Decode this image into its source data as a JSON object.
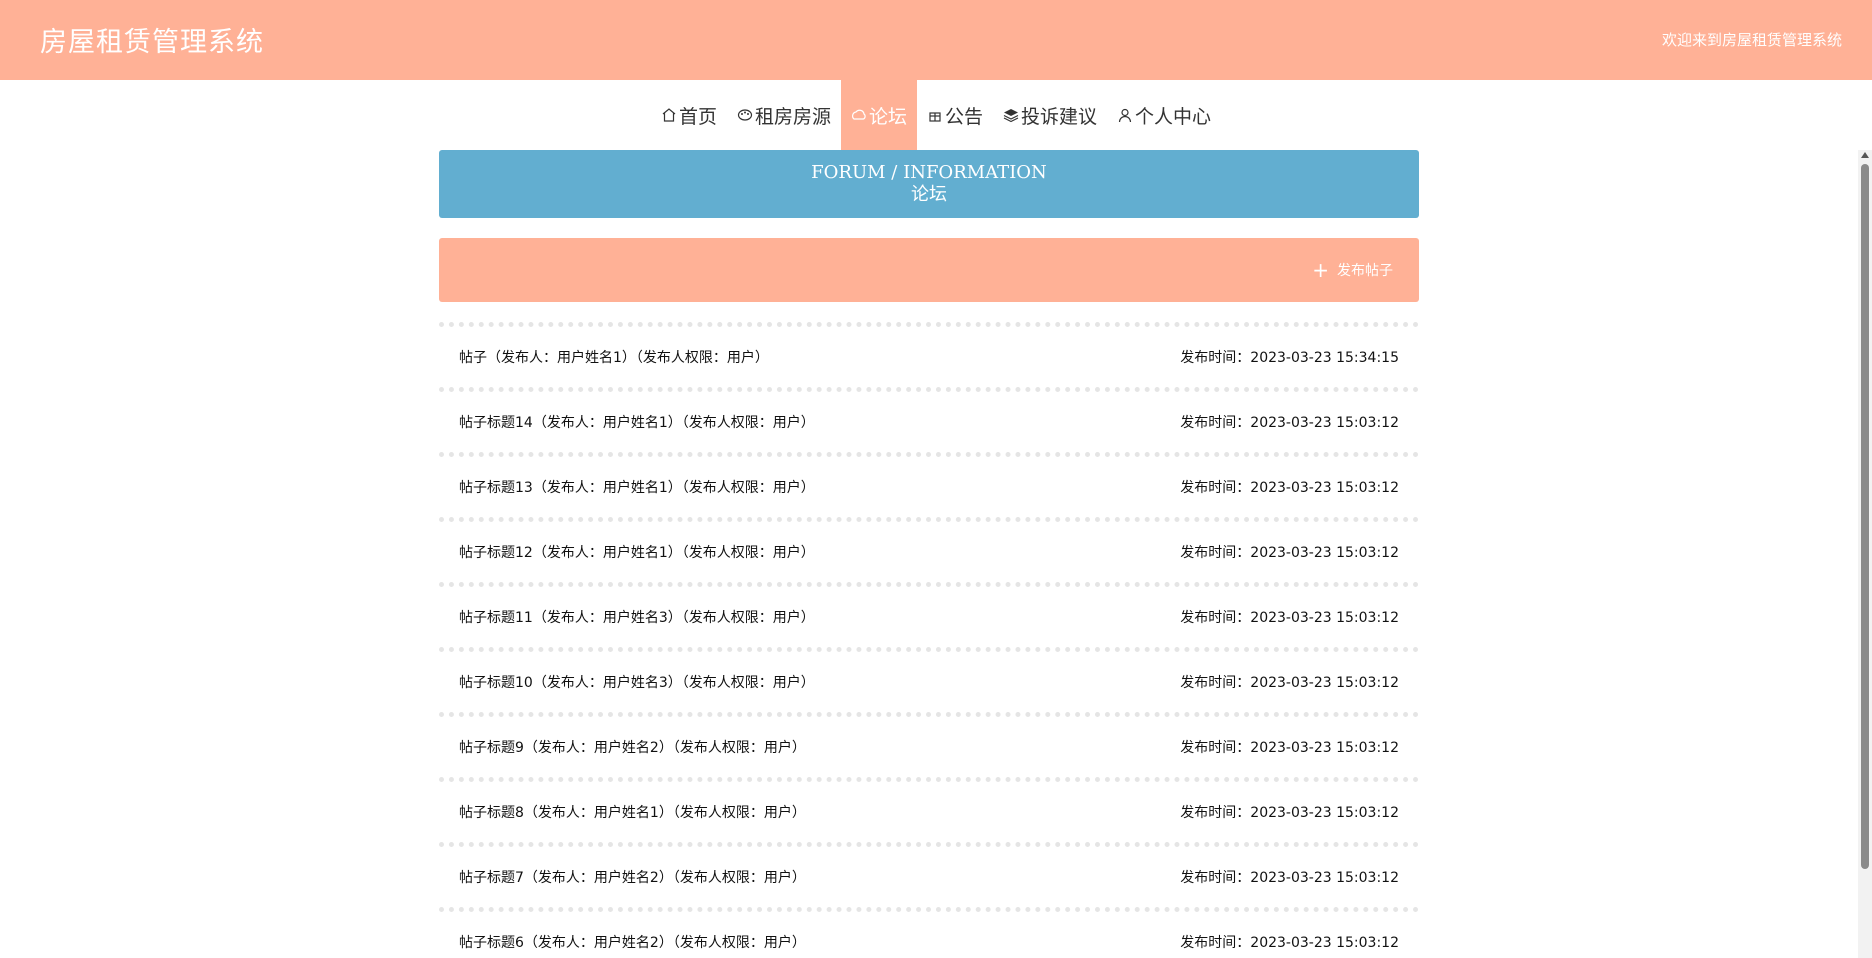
{
  "header": {
    "title": "房屋租赁管理系统",
    "welcome": "欢迎来到房屋租赁管理系统"
  },
  "nav": {
    "items": [
      {
        "label": "首页",
        "icon": "home-icon"
      },
      {
        "label": "租房房源",
        "icon": "palette-icon"
      },
      {
        "label": "论坛",
        "icon": "cloud-icon",
        "active": true
      },
      {
        "label": "公告",
        "icon": "gift-icon"
      },
      {
        "label": "投诉建议",
        "icon": "layers-icon"
      },
      {
        "label": "个人中心",
        "icon": "user-icon"
      }
    ]
  },
  "banner": {
    "title_en": "FORUM / INFORMATION",
    "title_cn": "论坛"
  },
  "actions": {
    "publish_label": "发布帖子",
    "publish_icon": "plus-icon"
  },
  "posts": [
    {
      "title": "帖子（发布人：用户姓名1）（发布人权限：用户）",
      "time": "发布时间：2023-03-23 15:34:15"
    },
    {
      "title": "帖子标题14（发布人：用户姓名1）（发布人权限：用户）",
      "time": "发布时间：2023-03-23 15:03:12"
    },
    {
      "title": "帖子标题13（发布人：用户姓名1）（发布人权限：用户）",
      "time": "发布时间：2023-03-23 15:03:12"
    },
    {
      "title": "帖子标题12（发布人：用户姓名1）（发布人权限：用户）",
      "time": "发布时间：2023-03-23 15:03:12"
    },
    {
      "title": "帖子标题11（发布人：用户姓名3）（发布人权限：用户）",
      "time": "发布时间：2023-03-23 15:03:12"
    },
    {
      "title": "帖子标题10（发布人：用户姓名3）（发布人权限：用户）",
      "time": "发布时间：2023-03-23 15:03:12"
    },
    {
      "title": "帖子标题9（发布人：用户姓名2）（发布人权限：用户）",
      "time": "发布时间：2023-03-23 15:03:12"
    },
    {
      "title": "帖子标题8（发布人：用户姓名1）（发布人权限：用户）",
      "time": "发布时间：2023-03-23 15:03:12"
    },
    {
      "title": "帖子标题7（发布人：用户姓名2）（发布人权限：用户）",
      "time": "发布时间：2023-03-23 15:03:12"
    },
    {
      "title": "帖子标题6（发布人：用户姓名2）（发布人权限：用户）",
      "time": "发布时间：2023-03-23 15:03:12"
    }
  ],
  "colors": {
    "header_bg": "#ffb196",
    "banner_bg": "#62aed0",
    "text": "#333333"
  }
}
